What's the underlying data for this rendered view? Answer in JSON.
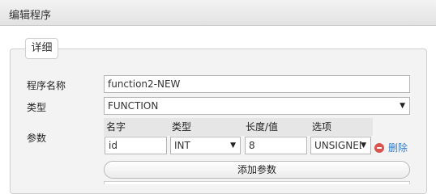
{
  "window": {
    "title": "编辑程序"
  },
  "section": {
    "legend": "详细"
  },
  "form": {
    "name_label": "程序名称",
    "name_value": "function2-NEW",
    "type_label": "类型",
    "type_value": "FUNCTION",
    "params_label": "参数"
  },
  "params": {
    "headers": {
      "name": "名字",
      "type": "类型",
      "length": "长度/值",
      "options": "选项"
    },
    "rows": [
      {
        "name": "id",
        "type": "INT",
        "length": "8",
        "options": "UNSIGNED",
        "delete_label": "删除"
      }
    ],
    "add_label": "添加参数"
  },
  "icons": {
    "dropdown": "chevron-down-icon",
    "delete": "minus-circle-icon"
  },
  "colors": {
    "delete_icon": "#d9534f",
    "link": "#3a7cc9"
  }
}
